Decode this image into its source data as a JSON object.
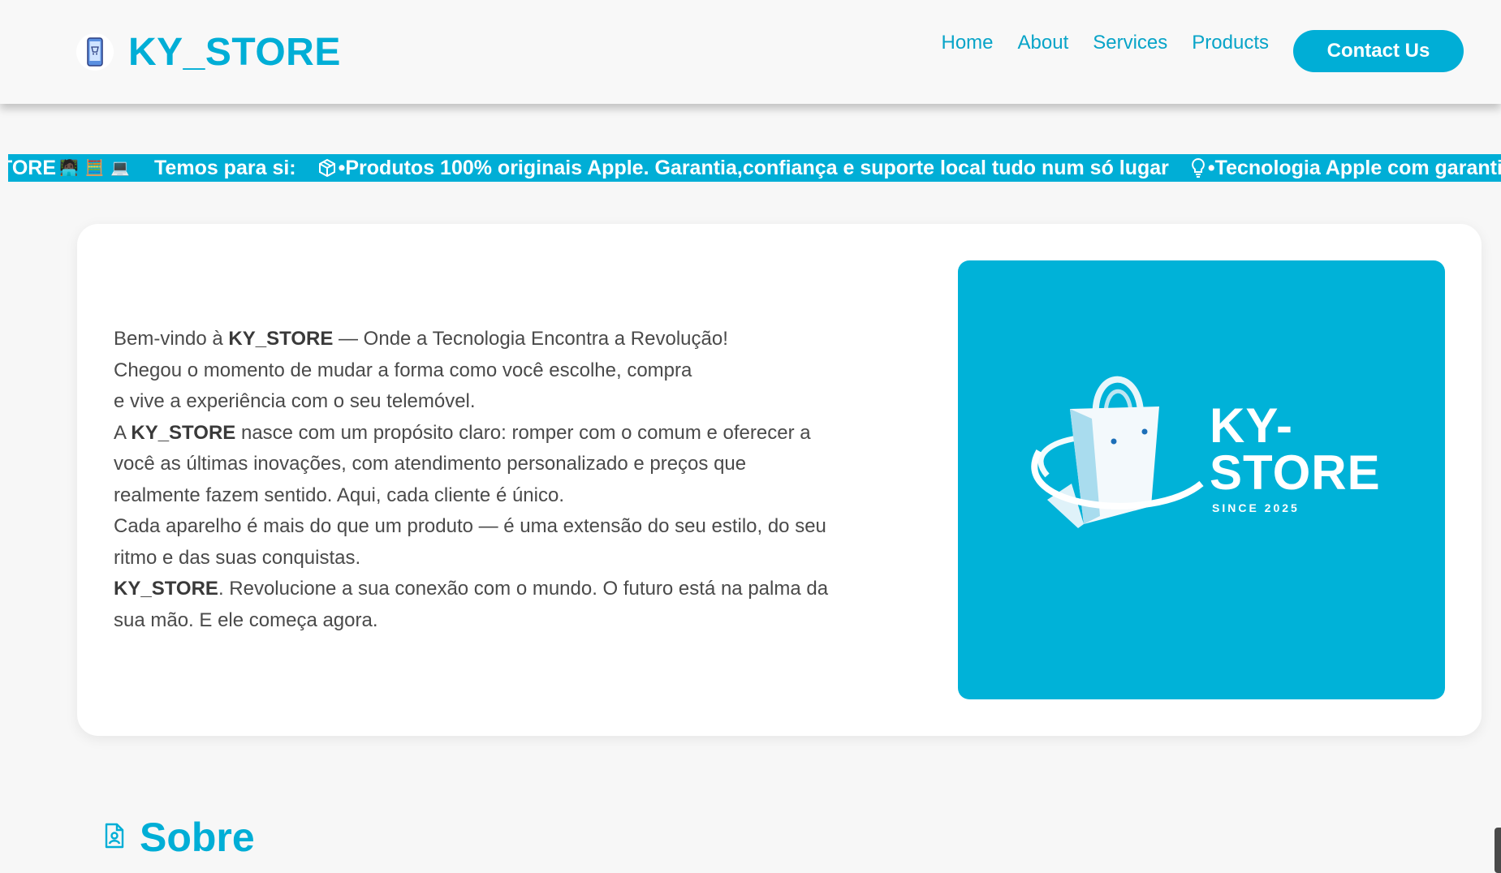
{
  "brand": {
    "name": "KY_STORE",
    "logo_icon": "phone-cart-icon",
    "accent_color": "#00aed6"
  },
  "nav": {
    "home": "Home",
    "about": "About",
    "services": "Services",
    "products": "Products",
    "contact": "Contact Us"
  },
  "marquee": {
    "lead_fragment": "TORE",
    "emoji_person": "🧑🏿‍💻",
    "emoji_calc": "🧮",
    "emoji_laptop": "💻",
    "heading": "Temos para si:",
    "item1": "•Produtos 100% originais Apple. Garantia,confiança e suporte local tudo num só lugar",
    "item2": "•Tecnologia Apple com garantia"
  },
  "hero": {
    "p1_a": "Bem-vindo à ",
    "p1_brand": "KY_STORE",
    "p1_b": " — Onde a Tecnologia Encontra a Revolução!",
    "p2": "Chegou o momento de mudar a forma como você escolhe, compra",
    "p3": "e vive a experiência com o seu telemóvel.",
    "p4_a": "A ",
    "p4_brand": "KY_STORE",
    "p4_b": " nasce com um propósito claro: romper com o comum e oferecer a",
    "p5": "você as últimas inovações, com atendimento personalizado e preços que",
    "p6": "realmente fazem sentido. Aqui, cada cliente é único.",
    "p7": "Cada aparelho é mais do que um produto — é uma extensão do seu estilo, do seu",
    "p8": "ritmo e das suas conquistas.",
    "p9_brand": "KY_STORE",
    "p9_b": ". Revolucione a sua conexão com o mundo. O futuro está na palma da",
    "p10": "sua mão. E ele começa agora.",
    "image": {
      "title_line1": "KY-",
      "title_line2": "STORE",
      "since": "SINCE 2025",
      "icon": "shopping-bag-icon",
      "bg_color": "#00b2d8"
    }
  },
  "about_section": {
    "icon": "person-document-icon",
    "title": "Sobre"
  }
}
